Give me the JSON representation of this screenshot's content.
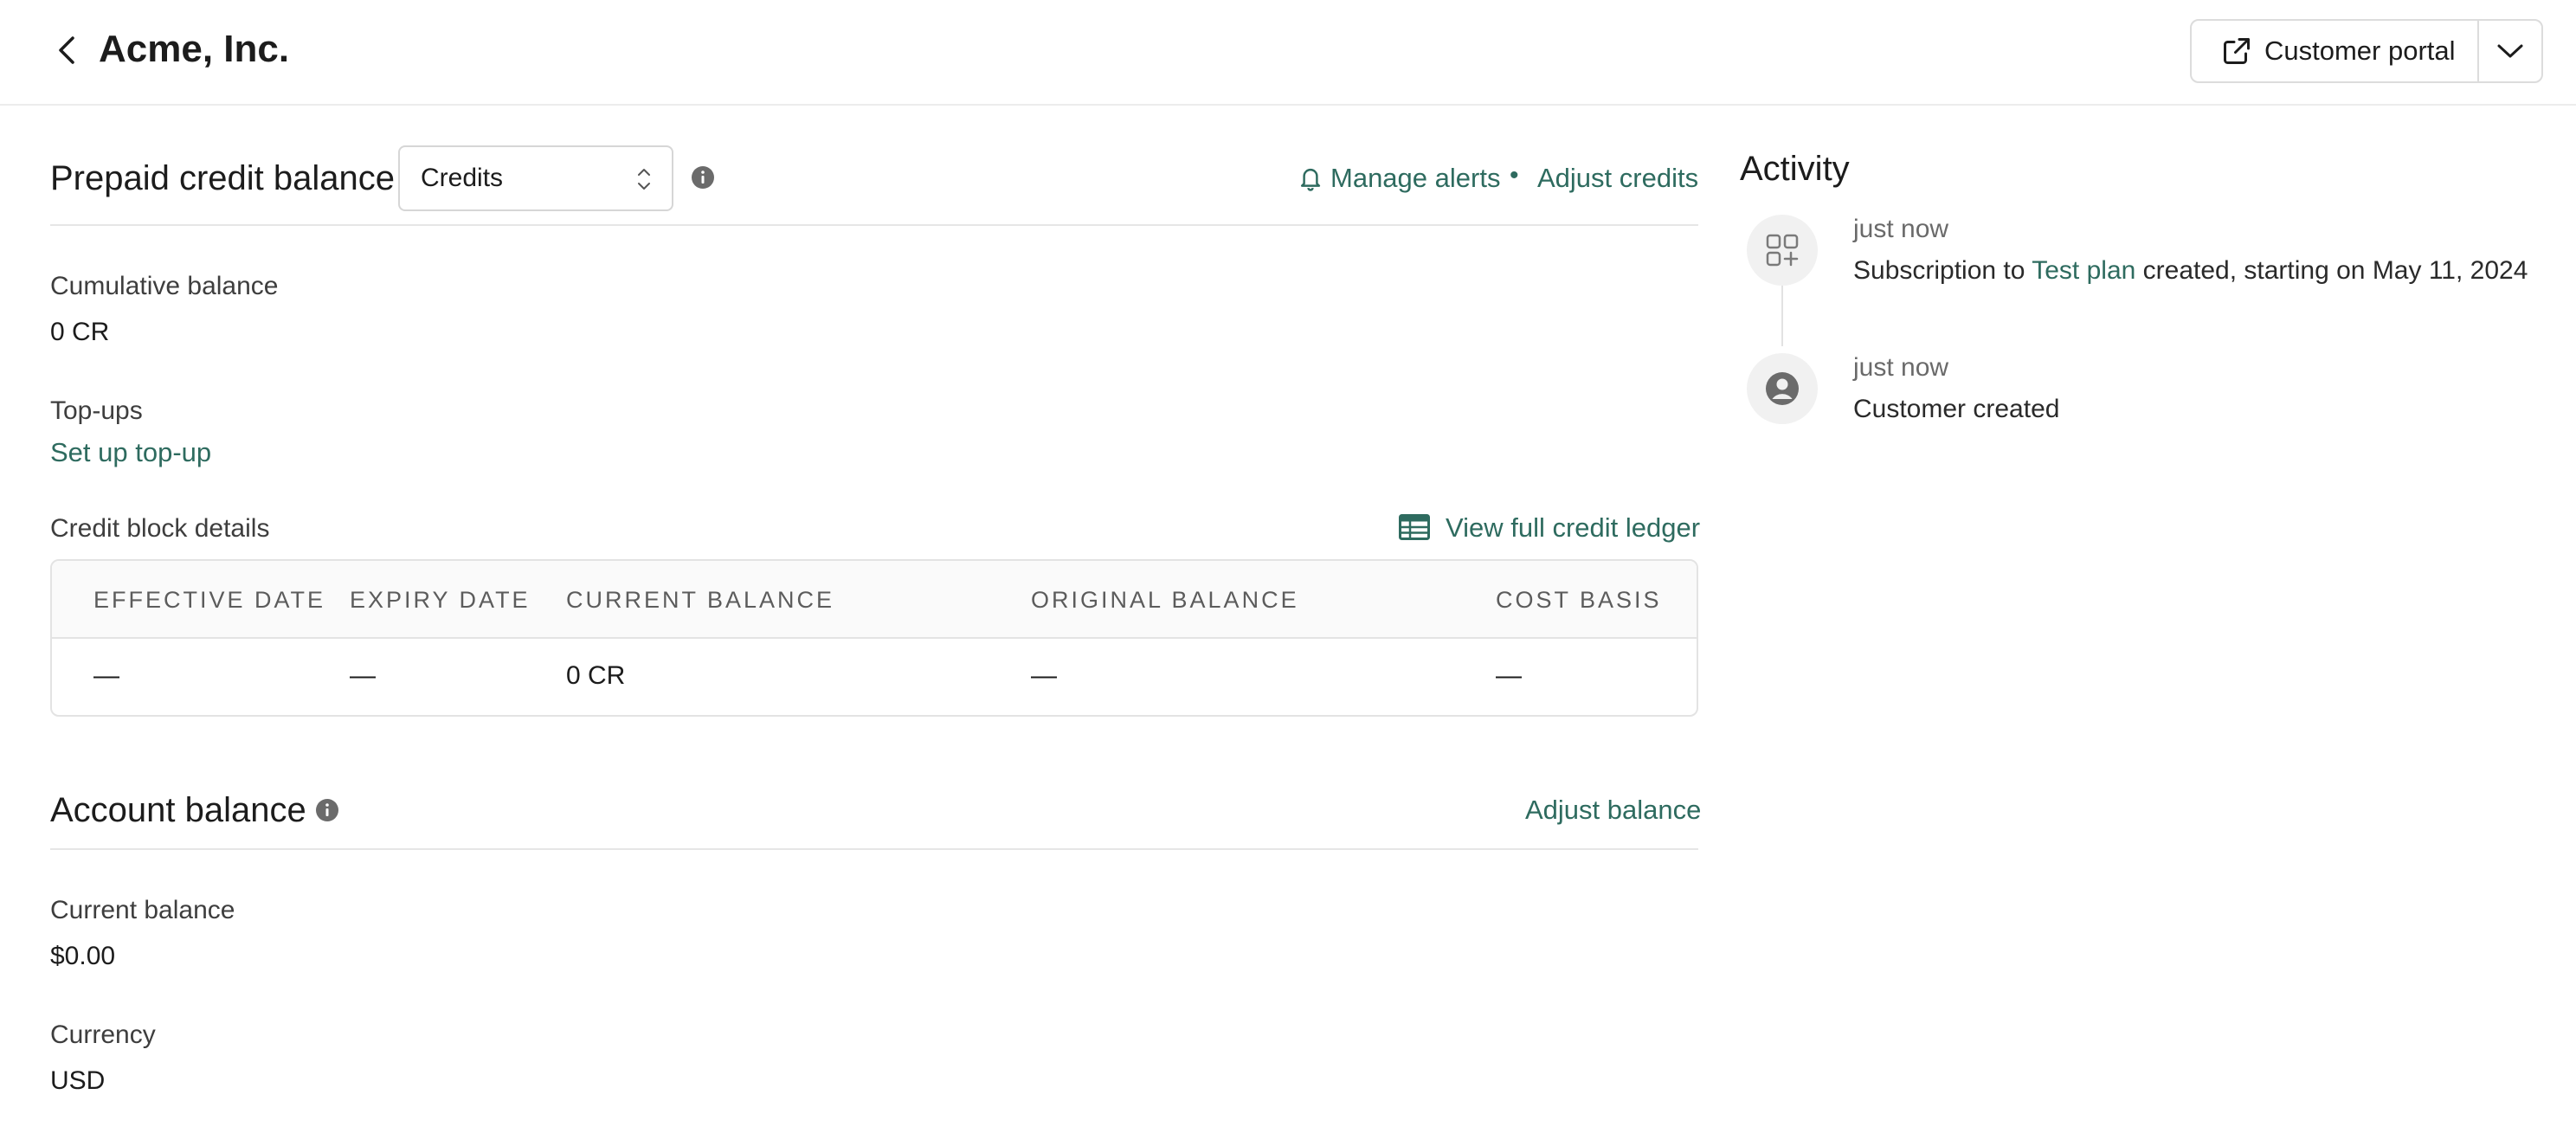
{
  "header": {
    "title": "Acme, Inc.",
    "customer_portal_label": "Customer portal"
  },
  "prepaid": {
    "title": "Prepaid credit balance",
    "unit_select_value": "Credits",
    "manage_alerts": "Manage alerts",
    "separator": "•",
    "adjust_credits": "Adjust credits",
    "cumulative_label": "Cumulative balance",
    "cumulative_value": "0 CR",
    "topups_label": "Top-ups",
    "topups_link": "Set up top-up",
    "credit_block_label": "Credit block details",
    "view_ledger": "View full credit ledger",
    "table": {
      "columns": [
        "EFFECTIVE DATE",
        "EXPIRY DATE",
        "CURRENT BALANCE",
        "ORIGINAL BALANCE",
        "COST BASIS"
      ],
      "rows": [
        [
          "—",
          "—",
          "0 CR",
          "—",
          "—"
        ]
      ]
    }
  },
  "account": {
    "title": "Account balance",
    "adjust_balance": "Adjust balance",
    "current_balance_label": "Current balance",
    "current_balance_value": "$0.00",
    "currency_label": "Currency",
    "currency_value": "USD"
  },
  "activity": {
    "title": "Activity",
    "items": [
      {
        "icon": "subscription-icon",
        "time": "just now",
        "text_before": "Subscription to ",
        "link": "Test plan",
        "text_after": " created, starting on May 11, 2024"
      },
      {
        "icon": "user-icon",
        "time": "just now",
        "text": "Customer created"
      }
    ]
  },
  "colors": {
    "link": "#2e6b5f",
    "border": "#e3e3e3",
    "icon_bg": "#f1f1f1"
  }
}
